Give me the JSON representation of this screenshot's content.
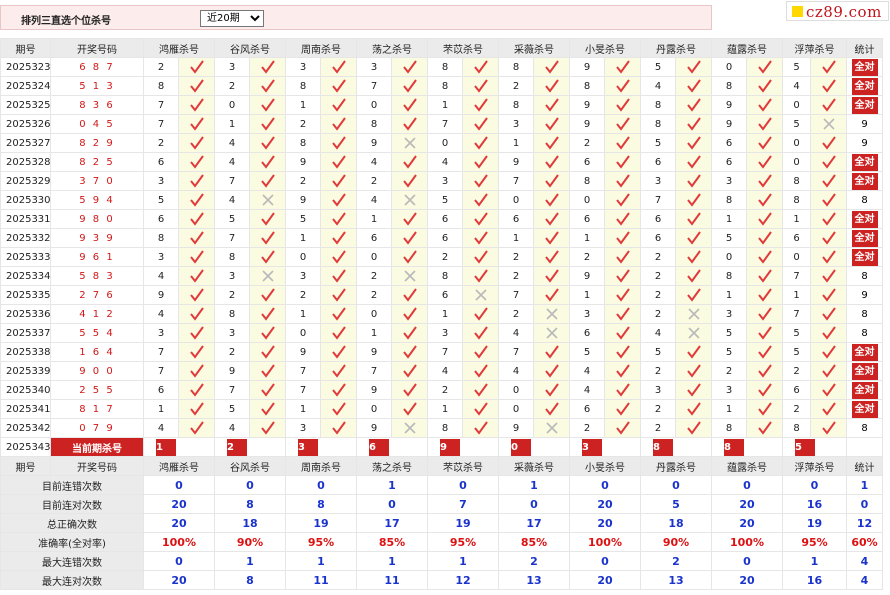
{
  "header": {
    "title": "排列三直选个位杀号",
    "period_select": "近20期",
    "logo_text": "cz89.com"
  },
  "columns": [
    "期号",
    "开奖号码",
    "鸿雁杀号",
    "谷风杀号",
    "周南杀号",
    "荡之杀号",
    "芣苡杀号",
    "采薇杀号",
    "小旻杀号",
    "丹露杀号",
    "蕴露杀号",
    "浮萍杀号",
    "统计"
  ],
  "full_label": "全对",
  "rows": [
    {
      "issue": "2025323",
      "lot": "687",
      "nums": [
        "2",
        "3",
        "3",
        "3",
        "8",
        "8",
        "9",
        "5",
        "0",
        "5"
      ],
      "res": [
        1,
        1,
        1,
        1,
        1,
        1,
        1,
        1,
        1,
        1
      ],
      "stat": "全对"
    },
    {
      "issue": "2025324",
      "lot": "513",
      "nums": [
        "8",
        "2",
        "8",
        "7",
        "8",
        "2",
        "8",
        "4",
        "8",
        "4"
      ],
      "res": [
        1,
        1,
        1,
        1,
        1,
        1,
        1,
        1,
        1,
        1
      ],
      "stat": "全对"
    },
    {
      "issue": "2025325",
      "lot": "836",
      "nums": [
        "7",
        "0",
        "1",
        "0",
        "1",
        "8",
        "9",
        "8",
        "9",
        "0"
      ],
      "res": [
        1,
        1,
        1,
        1,
        1,
        1,
        1,
        1,
        1,
        1
      ],
      "stat": "全对"
    },
    {
      "issue": "2025326",
      "lot": "045",
      "nums": [
        "7",
        "1",
        "2",
        "8",
        "7",
        "3",
        "9",
        "8",
        "9",
        "5"
      ],
      "res": [
        1,
        1,
        1,
        1,
        1,
        1,
        1,
        1,
        1,
        0
      ],
      "stat": "9"
    },
    {
      "issue": "2025327",
      "lot": "829",
      "nums": [
        "2",
        "4",
        "8",
        "9",
        "0",
        "1",
        "2",
        "5",
        "6",
        "0"
      ],
      "res": [
        1,
        1,
        1,
        0,
        1,
        1,
        1,
        1,
        1,
        1
      ],
      "stat": "9"
    },
    {
      "issue": "2025328",
      "lot": "825",
      "nums": [
        "6",
        "4",
        "9",
        "4",
        "4",
        "9",
        "6",
        "6",
        "6",
        "0"
      ],
      "res": [
        1,
        1,
        1,
        1,
        1,
        1,
        1,
        1,
        1,
        1
      ],
      "stat": "全对"
    },
    {
      "issue": "2025329",
      "lot": "370",
      "nums": [
        "3",
        "7",
        "2",
        "2",
        "3",
        "7",
        "8",
        "3",
        "3",
        "8"
      ],
      "res": [
        1,
        1,
        1,
        1,
        1,
        1,
        1,
        1,
        1,
        1
      ],
      "stat": "全对"
    },
    {
      "issue": "2025330",
      "lot": "594",
      "nums": [
        "5",
        "4",
        "9",
        "4",
        "5",
        "0",
        "0",
        "7",
        "8",
        "8"
      ],
      "res": [
        1,
        0,
        1,
        0,
        1,
        1,
        1,
        1,
        1,
        1
      ],
      "stat": "8"
    },
    {
      "issue": "2025331",
      "lot": "980",
      "nums": [
        "6",
        "5",
        "5",
        "1",
        "6",
        "6",
        "6",
        "6",
        "1",
        "1"
      ],
      "res": [
        1,
        1,
        1,
        1,
        1,
        1,
        1,
        1,
        1,
        1
      ],
      "stat": "全对"
    },
    {
      "issue": "2025332",
      "lot": "939",
      "nums": [
        "8",
        "7",
        "1",
        "6",
        "6",
        "1",
        "1",
        "6",
        "5",
        "6"
      ],
      "res": [
        1,
        1,
        1,
        1,
        1,
        1,
        1,
        1,
        1,
        1
      ],
      "stat": "全对"
    },
    {
      "issue": "2025333",
      "lot": "961",
      "nums": [
        "3",
        "8",
        "0",
        "0",
        "2",
        "2",
        "2",
        "2",
        "0",
        "0"
      ],
      "res": [
        1,
        1,
        1,
        1,
        1,
        1,
        1,
        1,
        1,
        1
      ],
      "stat": "全对"
    },
    {
      "issue": "2025334",
      "lot": "583",
      "nums": [
        "4",
        "3",
        "3",
        "2",
        "8",
        "2",
        "9",
        "2",
        "8",
        "7"
      ],
      "res": [
        1,
        0,
        1,
        0,
        1,
        1,
        1,
        1,
        1,
        1
      ],
      "stat": "8"
    },
    {
      "issue": "2025335",
      "lot": "276",
      "nums": [
        "9",
        "2",
        "2",
        "2",
        "6",
        "7",
        "1",
        "2",
        "1",
        "1"
      ],
      "res": [
        1,
        1,
        1,
        1,
        0,
        1,
        1,
        1,
        1,
        1
      ],
      "stat": "9"
    },
    {
      "issue": "2025336",
      "lot": "412",
      "nums": [
        "4",
        "8",
        "1",
        "0",
        "1",
        "2",
        "3",
        "2",
        "3",
        "7"
      ],
      "res": [
        1,
        1,
        1,
        1,
        1,
        0,
        1,
        0,
        1,
        1
      ],
      "stat": "8"
    },
    {
      "issue": "2025337",
      "lot": "554",
      "nums": [
        "3",
        "3",
        "0",
        "1",
        "3",
        "4",
        "6",
        "4",
        "5",
        "5"
      ],
      "res": [
        1,
        1,
        1,
        1,
        1,
        0,
        1,
        0,
        1,
        1
      ],
      "stat": "8"
    },
    {
      "issue": "2025338",
      "lot": "164",
      "nums": [
        "7",
        "2",
        "9",
        "9",
        "7",
        "7",
        "5",
        "5",
        "5",
        "5"
      ],
      "res": [
        1,
        1,
        1,
        1,
        1,
        1,
        1,
        1,
        1,
        1
      ],
      "stat": "全对"
    },
    {
      "issue": "2025339",
      "lot": "900",
      "nums": [
        "7",
        "9",
        "7",
        "7",
        "4",
        "4",
        "4",
        "2",
        "2",
        "2"
      ],
      "res": [
        1,
        1,
        1,
        1,
        1,
        1,
        1,
        1,
        1,
        1
      ],
      "stat": "全对"
    },
    {
      "issue": "2025340",
      "lot": "255",
      "nums": [
        "6",
        "7",
        "7",
        "9",
        "2",
        "0",
        "4",
        "3",
        "3",
        "6"
      ],
      "res": [
        1,
        1,
        1,
        1,
        1,
        1,
        1,
        1,
        1,
        1
      ],
      "stat": "全对"
    },
    {
      "issue": "2025341",
      "lot": "817",
      "nums": [
        "1",
        "5",
        "1",
        "0",
        "1",
        "0",
        "6",
        "2",
        "1",
        "2"
      ],
      "res": [
        1,
        1,
        1,
        1,
        1,
        1,
        1,
        1,
        1,
        1
      ],
      "stat": "全对"
    },
    {
      "issue": "2025342",
      "lot": "079",
      "nums": [
        "4",
        "4",
        "3",
        "9",
        "8",
        "9",
        "2",
        "2",
        "8",
        "8"
      ],
      "res": [
        1,
        1,
        1,
        0,
        1,
        0,
        1,
        1,
        1,
        1
      ],
      "stat": "8"
    }
  ],
  "current": {
    "issue": "2025343",
    "label": "当前期杀号",
    "nums": [
      "1",
      "2",
      "3",
      "6",
      "9",
      "0",
      "3",
      "8",
      "8",
      "5"
    ]
  },
  "stats": [
    {
      "label": "目前连错次数",
      "values": [
        "0",
        "0",
        "0",
        "1",
        "0",
        "1",
        "0",
        "0",
        "0",
        "0",
        "1"
      ],
      "red": false
    },
    {
      "label": "目前连对次数",
      "values": [
        "20",
        "8",
        "8",
        "0",
        "7",
        "0",
        "20",
        "5",
        "20",
        "16",
        "0"
      ],
      "red": false
    },
    {
      "label": "总正确次数",
      "values": [
        "20",
        "18",
        "19",
        "17",
        "19",
        "17",
        "20",
        "18",
        "20",
        "19",
        "12"
      ],
      "red": false
    },
    {
      "label": "准确率(全对率)",
      "values": [
        "100%",
        "90%",
        "95%",
        "85%",
        "95%",
        "85%",
        "100%",
        "90%",
        "100%",
        "95%",
        "60%"
      ],
      "red": true
    },
    {
      "label": "最大连错次数",
      "values": [
        "0",
        "1",
        "1",
        "1",
        "1",
        "2",
        "0",
        "2",
        "0",
        "1",
        "4"
      ],
      "red": false
    },
    {
      "label": "最大连对次数",
      "values": [
        "20",
        "8",
        "11",
        "11",
        "12",
        "13",
        "20",
        "13",
        "20",
        "16",
        "4"
      ],
      "red": false
    }
  ]
}
